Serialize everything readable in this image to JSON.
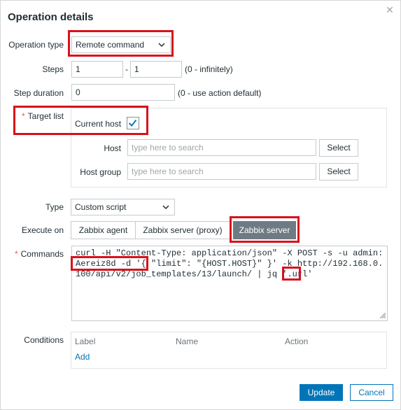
{
  "dialog": {
    "title": "Operation details",
    "close_icon": "close-icon"
  },
  "operation_type": {
    "label": "Operation type",
    "value": "Remote command"
  },
  "steps": {
    "label": "Steps",
    "from": "1",
    "separator": "-",
    "to": "1",
    "hint": "(0 - infinitely)"
  },
  "step_duration": {
    "label": "Step duration",
    "value": "0",
    "hint": "(0 - use action default)"
  },
  "target_list": {
    "required_mark": "*",
    "label": "Target list",
    "current_host_label": "Current host",
    "current_host_checked": true,
    "host_label": "Host",
    "host_placeholder": "type here to search",
    "host_select": "Select",
    "host_group_label": "Host group",
    "host_group_placeholder": "type here to search",
    "host_group_select": "Select"
  },
  "type": {
    "label": "Type",
    "value": "Custom script"
  },
  "execute_on": {
    "label": "Execute on",
    "options": [
      "Zabbix agent",
      "Zabbix server (proxy)",
      "Zabbix server"
    ],
    "selected": "Zabbix server"
  },
  "commands": {
    "required_mark": "*",
    "label": "Commands",
    "value": "curl -H \"Content-Type: application/json\" -X POST -s -u admin:Aereiz8d -d '{ \"limit\": \"{HOST.HOST}\" }' -k http://192.168.0.100/api/v2/job_templates/13/launch/ | jq '.url'"
  },
  "conditions": {
    "label": "Conditions",
    "columns": [
      "Label",
      "Name",
      "Action"
    ],
    "add_link": "Add"
  },
  "footer": {
    "update": "Update",
    "cancel": "Cancel"
  },
  "colors": {
    "primary": "#0275b8",
    "highlight": "#d8111b",
    "active_segment": "#6e7b84"
  }
}
